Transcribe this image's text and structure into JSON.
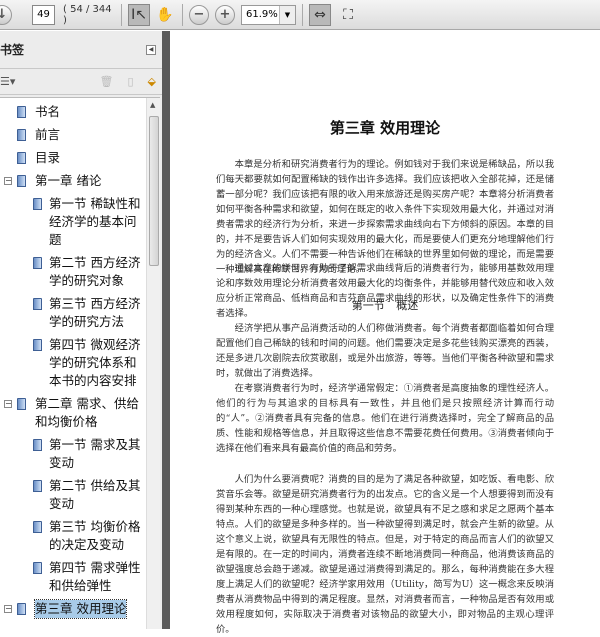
{
  "toolbar": {
    "page_number": "49",
    "page_count": "( 54 / 344 )",
    "zoom": "61.9%"
  },
  "sidebar": {
    "title": "书签",
    "items": [
      {
        "label": "书名"
      },
      {
        "label": "前言"
      },
      {
        "label": "目录"
      },
      {
        "label": "第一章  绪论",
        "expanded": true,
        "children": [
          {
            "label": "第一节  稀缺性和经济学的基本问题"
          },
          {
            "label": "第二节  西方经济学的研究对象"
          },
          {
            "label": "第三节  西方经济学的研究方法"
          },
          {
            "label": "第四节  微观经济学的研究体系和本书的内容安排"
          }
        ]
      },
      {
        "label": "第二章  需求、供给和均衡价格",
        "expanded": true,
        "children": [
          {
            "label": "第一节  需求及其变动"
          },
          {
            "label": "第二节  供给及其变动"
          },
          {
            "label": "第三节  均衡价格的决定及变动"
          },
          {
            "label": "第四节  需求弹性和供给弹性"
          }
        ]
      },
      {
        "label": "第三章  效用理论",
        "expanded": true,
        "selected": true
      }
    ]
  },
  "document": {
    "chapter_title": "第三章  效用理论",
    "intro": [
      "本章是分析和研究消费者行为的理论。例如钱对于我们来说是稀缺品，所以我们每天都要就如何配置稀缺的钱作出许多选择。我们应该把收入全部花掉，还是储蓄一部分呢？我们应该把有限的收入用来旅游还是购买房产呢？本章将分析消费者如何平衡各种需求和欲望，如何在既定的收入条件下实现效用最大化，并通过对消费者需求的经济行为分析，来进一步探索需求曲线向右下方倾斜的原因。本章的目的，并不是要告诉人们如何实现效用的最大化，而是要使人们更充分地理解他们行为的经济含义。人们不需要一种告诉他们在稀缺的世界里如何做的理论，而是需要一种理解其在稀缺世界行为的理论。",
      "通过本章的学习，有助于了解需求曲线背后的消费者行为，能够用基数效用理论和序数效用理论分析消费者效用最大化的均衡条件，并能够用替代效应和收入效应分析正常商品、低档商品和吉芬商品需求曲线的形状，以及确定性条件下的消费者选择。"
    ],
    "section_title": "第一节  概述",
    "section_paras": [
      "经济学把从事产品消费活动的人们称做消费者。每个消费者都面临着如何合理配置他们自己稀缺的钱和时间的问题。他们需要决定是多花些钱购买漂亮的西装，还是多进几次剧院去欣赏歌剧，或是外出旅游，等等。当他们平衡各种欲望和需求时，就做出了消费选择。",
      "在考察消费者行为时，经济学通常假定：①消费者是高度抽象的理性经济人。他们的行为与其追求的目标具有一致性，并且他们是只按照经济计算而行动的“人”。②消费者具有完备的信息。他们在进行消费选择时，完全了解商品的品质、性能和规格等信息，并且取得这些信息不需要花费任何费用。③消费者倾向于选择在他们看来具有最高价值的商品和劳务。",
      "人们为什么要消费呢？消费的目的是为了满足各种欲望，如吃饭、看电影、欣赏音乐会等。欲望是研究消费者行为的出发点。它的含义是一个人想要得到而没有得到某种东西的一种心理感觉。也就是说，欲望具有不足之感和求足之愿两个基本特点。人们的欲望是多种多样的。当一种欲望得到满足时，就会产生新的欲望。从这个意义上说，欲望具有无限性的特点。但是，对于特定的商品而言人们的欲望又是有限的。在一定的时间内，消费者连续不断地消费同一种商品，他消费该商品的欲望强度总会趋于递减。欲望是通过消费得到满足的。那么，每种消费能在多大程度上满足人们的欲望呢？经济学家用效用（Utility，简写为U）这一概念来反映消费者从消费物品中得到的满足程度。显然，对消费者而言，一种物品是否有效用或效用程度如何，实际取决于消费者对该物品的欲望大小，即对物品的主观心理评价。"
    ]
  }
}
